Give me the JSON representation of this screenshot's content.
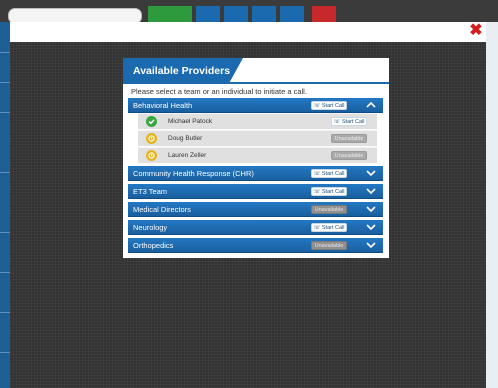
{
  "background": {
    "toolbar_icons": [
      "print-icon",
      "document-icon",
      "people-icon",
      "phone-icon",
      "close-icon"
    ]
  },
  "modal": {
    "title": "Available Providers",
    "instruction": "Please select a team or an individual to initiate a call.",
    "close_glyph": "✖",
    "groups": [
      {
        "name": "Behavioral Health",
        "action": "Start Call",
        "action_state": "available",
        "expanded": true,
        "members": [
          {
            "name": "Michael Patock",
            "status": "available",
            "action": "Start Call"
          },
          {
            "name": "Doug Butler",
            "status": "unavailable",
            "action": "Unavailable"
          },
          {
            "name": "Lauren Zeller",
            "status": "unavailable",
            "action": "Unavailable"
          }
        ]
      },
      {
        "name": "Community Health Response (CHR)",
        "action": "Start Call",
        "action_state": "available",
        "expanded": false
      },
      {
        "name": "ET3 Team",
        "action": "Start Call",
        "action_state": "available",
        "expanded": false
      },
      {
        "name": "Medical Directors",
        "action": "Unavailable",
        "action_state": "unavailable",
        "expanded": false
      },
      {
        "name": "Neurology",
        "action": "Start Call",
        "action_state": "available",
        "expanded": false
      },
      {
        "name": "Orthopedics",
        "action": "Unavailable",
        "action_state": "unavailable",
        "expanded": false
      }
    ]
  },
  "colors": {
    "header_blue": "#1b6ab0",
    "available_green": "#37a63c",
    "away_yellow": "#e3b51c",
    "close_red": "#d21f1f"
  }
}
